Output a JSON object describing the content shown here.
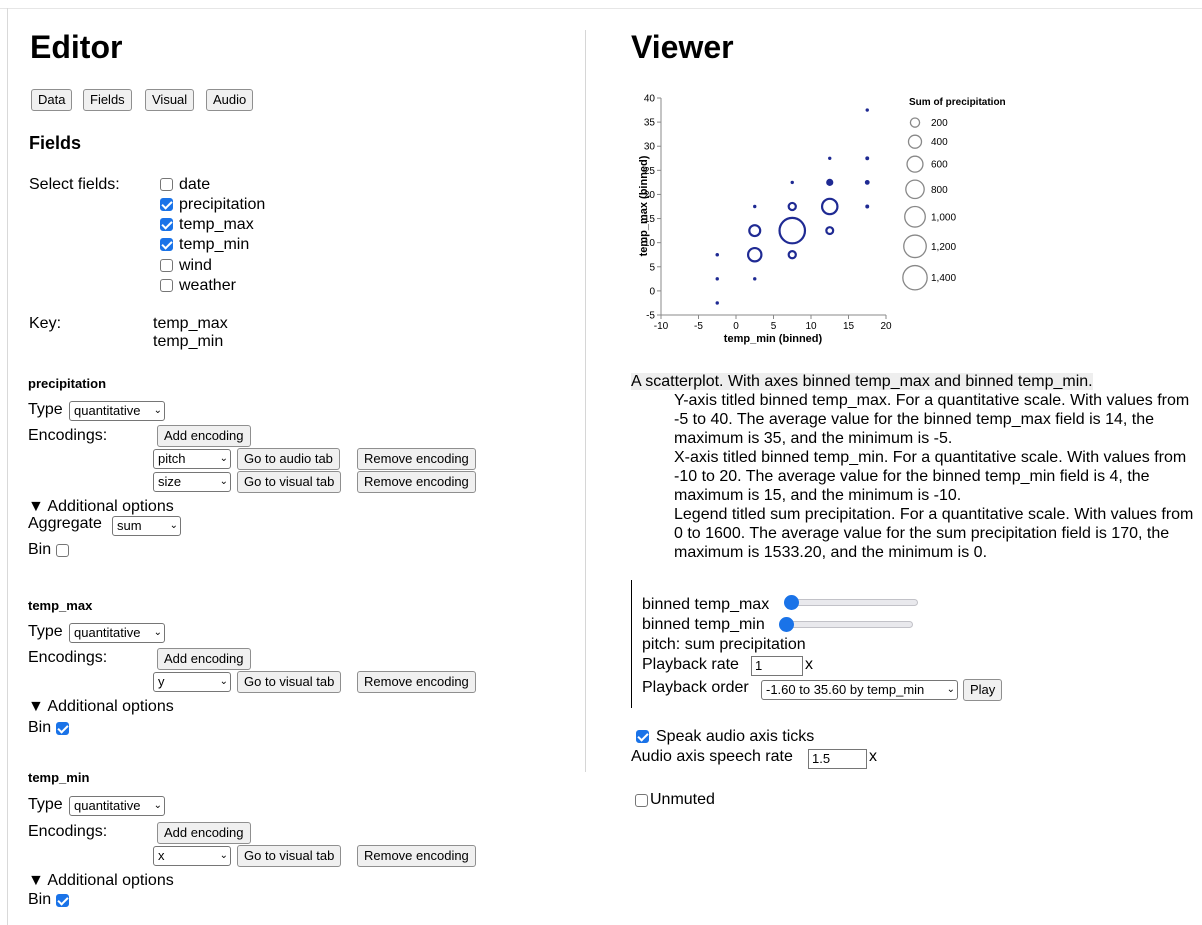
{
  "editor": {
    "title": "Editor",
    "tabs": [
      "Data",
      "Fields",
      "Visual",
      "Audio"
    ],
    "section_title": "Fields",
    "select_fields_label": "Select fields:",
    "fields": [
      {
        "name": "date",
        "checked": false
      },
      {
        "name": "precipitation",
        "checked": true
      },
      {
        "name": "temp_max",
        "checked": true
      },
      {
        "name": "temp_min",
        "checked": true
      },
      {
        "name": "wind",
        "checked": false
      },
      {
        "name": "weather",
        "checked": false
      }
    ],
    "key_label": "Key:",
    "key_values": [
      "temp_max",
      "temp_min"
    ],
    "field_configs": [
      {
        "name": "precipitation",
        "type_label": "Type",
        "type_value": "quantitative",
        "encodings_label": "Encodings:",
        "add_label": "Add encoding",
        "encodings": [
          {
            "channel": "pitch",
            "goto": "Go to audio tab",
            "remove": "Remove encoding"
          },
          {
            "channel": "size",
            "goto": "Go to visual tab",
            "remove": "Remove encoding"
          }
        ],
        "options_label": "▼ Additional options",
        "aggregate_label": "Aggregate",
        "aggregate_value": "sum",
        "bin_label": "Bin",
        "bin_checked": false
      },
      {
        "name": "temp_max",
        "type_label": "Type",
        "type_value": "quantitative",
        "encodings_label": "Encodings:",
        "add_label": "Add encoding",
        "encodings": [
          {
            "channel": "y",
            "goto": "Go to visual tab",
            "remove": "Remove encoding"
          }
        ],
        "options_label": "▼ Additional options",
        "bin_label": "Bin",
        "bin_checked": true
      },
      {
        "name": "temp_min",
        "type_label": "Type",
        "type_value": "quantitative",
        "encodings_label": "Encodings:",
        "add_label": "Add encoding",
        "encodings": [
          {
            "channel": "x",
            "goto": "Go to visual tab",
            "remove": "Remove encoding"
          }
        ],
        "options_label": "▼ Additional options",
        "bin_label": "Bin",
        "bin_checked": true
      }
    ]
  },
  "viewer": {
    "title": "Viewer",
    "description": {
      "summary": "A scatterplot. With axes binned temp_max and binned temp_min.",
      "lines": [
        "Y-axis titled binned temp_max. For a quantitative scale. With values from -5 to 40. The average value for the binned temp_max field is 14, the maximum is 35, and the minimum is -5.",
        "X-axis titled binned temp_min. For a quantitative scale. With values from -10 to 20. The average value for the binned temp_min field is 4, the maximum is 15, and the minimum is -10.",
        "Legend titled sum precipitation. For a quantitative scale. With values from 0 to 1600. The average value for the sum precipitation field is 170, the maximum is 1533.20, and the minimum is 0."
      ]
    },
    "sonification": {
      "slider1_label": "binned temp_max",
      "slider1_value": 0,
      "slider2_label": "binned temp_min",
      "slider2_value": 0,
      "pitch_label": "pitch: sum precipitation",
      "rate_label": "Playback rate",
      "rate_value": "1",
      "rate_unit": "x",
      "order_label": "Playback order",
      "order_value": "-1.60 to 35.60 by temp_min",
      "play_label": "Play"
    },
    "speak_label": "Speak audio axis ticks",
    "speak_checked": true,
    "speech_rate_label": "Audio axis speech rate",
    "speech_rate_value": "1.5",
    "speech_rate_unit": "x",
    "unmuted_label": "Unmuted",
    "unmuted_checked": false
  },
  "chart_data": {
    "type": "scatter",
    "xlabel": "temp_min (binned)",
    "ylabel": "temp_max (binned)",
    "xlim": [
      -10,
      20
    ],
    "ylim": [
      -5,
      40
    ],
    "xticks": [
      -10,
      -5,
      0,
      5,
      10,
      15,
      20
    ],
    "yticks": [
      -5,
      0,
      5,
      10,
      15,
      20,
      25,
      30,
      35,
      40
    ],
    "mark_color": "#1f2a93",
    "legend": {
      "title": "Sum of precipitation",
      "values": [
        200,
        400,
        600,
        800,
        1000,
        1200,
        1400
      ],
      "labels": [
        "200",
        "400",
        "600",
        "800",
        "1,000",
        "1,200",
        "1,400"
      ],
      "placement": "right"
    },
    "points": [
      {
        "x": -2.5,
        "y": -2.5,
        "size": 5
      },
      {
        "x": -2.5,
        "y": 2.5,
        "size": 10
      },
      {
        "x": -2.5,
        "y": 7.5,
        "size": 15
      },
      {
        "x": 2.5,
        "y": 2.5,
        "size": 8
      },
      {
        "x": 2.5,
        "y": 7.5,
        "size": 420
      },
      {
        "x": 2.5,
        "y": 12.5,
        "size": 280
      },
      {
        "x": 2.5,
        "y": 17.5,
        "size": 3
      },
      {
        "x": 7.5,
        "y": 7.5,
        "size": 120
      },
      {
        "x": 7.5,
        "y": 12.5,
        "size": 1533.2
      },
      {
        "x": 7.5,
        "y": 17.5,
        "size": 120
      },
      {
        "x": 7.5,
        "y": 22.5,
        "size": 2
      },
      {
        "x": 12.5,
        "y": 12.5,
        "size": 110
      },
      {
        "x": 12.5,
        "y": 17.5,
        "size": 560
      },
      {
        "x": 12.5,
        "y": 22.5,
        "size": 90
      },
      {
        "x": 12.5,
        "y": 27.5,
        "size": 1
      },
      {
        "x": 17.5,
        "y": 17.5,
        "size": 20
      },
      {
        "x": 17.5,
        "y": 22.5,
        "size": 35
      },
      {
        "x": 17.5,
        "y": 27.5,
        "size": 20
      },
      {
        "x": 17.5,
        "y": 37.5,
        "size": 2
      }
    ]
  }
}
